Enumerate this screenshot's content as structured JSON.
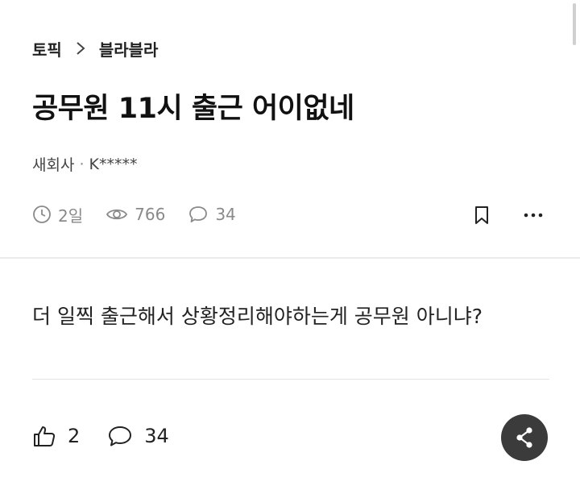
{
  "breadcrumb": {
    "topic_label": "토픽",
    "board_label": "블라블라"
  },
  "post": {
    "title": "공무원 11시 출근 어이없네",
    "author_company": "새회사",
    "author_separator": "·",
    "author_name": "K*****",
    "time_ago": "2일",
    "views": "766",
    "comments": "34",
    "body": "더 일찍 출근해서 상황정리해야하는게 공무원 아니냐?"
  },
  "actions": {
    "likes": "2",
    "comments": "34"
  },
  "icons": {
    "clock": "clock-icon",
    "views": "eye-icon",
    "comments": "speech-bubble-icon",
    "bookmark": "bookmark-icon",
    "more": "more-horizontal-icon",
    "like": "thumbs-up-icon",
    "share": "share-icon"
  },
  "colors": {
    "share_button_bg": "#3b3b3b",
    "meta_text": "#8a8a8a"
  }
}
